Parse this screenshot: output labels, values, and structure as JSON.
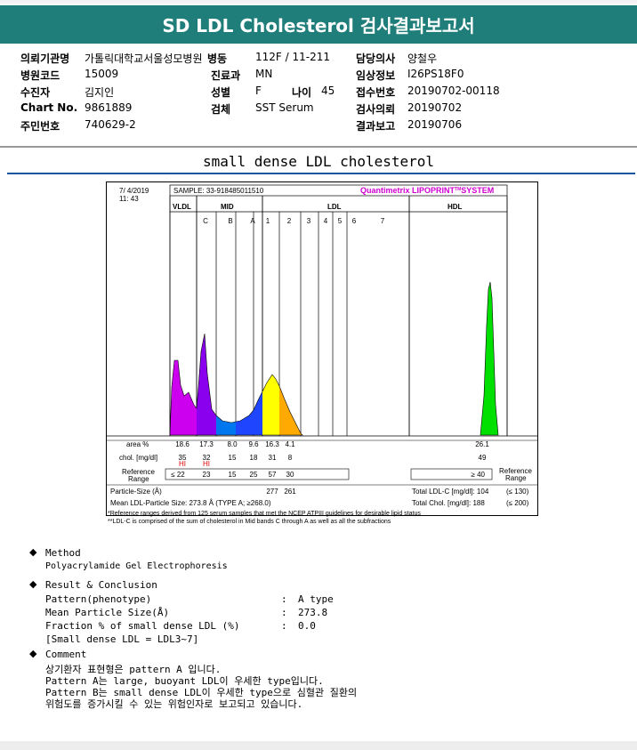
{
  "header": {
    "title": "SD LDL Cholesterol 검사결과보고서"
  },
  "info": {
    "rows": [
      [
        {
          "label": "의뢰기관명",
          "value": "가톨릭대학교서울성모병원"
        },
        {
          "label": "병동",
          "value": "112F / 11-211"
        },
        {
          "label": "담당의사",
          "value": "양철우"
        }
      ],
      [
        {
          "label": "병원코드",
          "value": "15009"
        },
        {
          "label": "진료과",
          "value": "MN"
        },
        {
          "label": "임상정보",
          "value": "I26PS18F0"
        }
      ],
      [
        {
          "label": "수진자",
          "value": "김지인"
        },
        {
          "label": "성별",
          "value": "F"
        },
        {
          "label": "접수번호",
          "value": "20190702-00118"
        }
      ],
      [
        {
          "label": "Chart No.",
          "value": "9861889"
        },
        {
          "label": "검체",
          "value": "SST Serum"
        },
        {
          "label": "검사의뢰",
          "value": "20190702"
        }
      ],
      [
        {
          "label": "주민번호",
          "value": "740629-2"
        },
        {
          "label": "",
          "value": ""
        },
        {
          "label": "결과보고",
          "value": "20190706"
        }
      ]
    ],
    "age_label": "나이",
    "age_value": "45"
  },
  "section_title": "small dense LDL cholesterol",
  "chart": {
    "date": "7/ 4/2019",
    "time": "11: 43",
    "sample": "SAMPLE:  33-918485011510",
    "brand": "Quantimetrix LIPOPRINT",
    "brand_tm": "TM",
    "brand_suffix": "SYSTEM",
    "group_vldl": "VLDL",
    "group_mid": "MID",
    "group_ldl": "LDL",
    "group_hdl": "HDL",
    "sub_bands": [
      "C",
      "B",
      "A",
      "1",
      "2",
      "3",
      "4",
      "5",
      "6",
      "7"
    ],
    "row_labels": {
      "area": "area %",
      "chol": "chol. [mg/dl]",
      "ref": "Reference Range",
      "particle": "Particle-Size (Å)",
      "mean": "Mean LDL-Particle Size:  273.8 Å  (TYPE A; ≥268.0)"
    },
    "area": [
      "18.6",
      "17.3",
      "8.0",
      "9.6",
      "16.3",
      "4.1"
    ],
    "area_hdl": "26.1",
    "chol": [
      "35",
      "32",
      "15",
      "18",
      "31",
      "8"
    ],
    "chol_hdl": "49",
    "hi": [
      "HI",
      "HI"
    ],
    "ref": [
      "≤ 22",
      "23",
      "15",
      "25",
      "57",
      "30"
    ],
    "ref_hdl": "≥ 40",
    "ref_side": "Reference Range",
    "particle": [
      "277",
      "261"
    ],
    "total_ldl": "Total LDL-C [mg/dl]:  104",
    "total_ldl_ref": "(≤ 130)",
    "total_chol": "Total Chol. [mg/dl]:  188",
    "total_chol_ref": "(≤ 200)"
  },
  "chart_data": {
    "type": "area",
    "title": "small dense LDL cholesterol",
    "bands": [
      "VLDL",
      "C",
      "B",
      "A",
      "1",
      "2",
      "3",
      "HDL"
    ],
    "area_percent": [
      18.6,
      17.3,
      8.0,
      9.6,
      16.3,
      4.1,
      26.1
    ],
    "chol_mg_dl": [
      35,
      32,
      15,
      18,
      31,
      8,
      49
    ],
    "colors": {
      "vldl": "#cc00ee",
      "c": "#8a00ee",
      "b": "#0077ee",
      "a": "#1f45ff",
      "ldl1": "#ffff00",
      "ldl2": "#ffaa00",
      "hdl": "#00e000"
    }
  },
  "footnotes": [
    "*Reference ranges derived from 125 serum samples that met the NCEP ATPIII guidelines for desirable lipid status",
    "**LDL-C is comprised of the sum of cholesterol in Mid bands C through A as well as all the subfractions"
  ],
  "method": {
    "title": "Method",
    "body": "Polyacrylamide Gel Electrophoresis"
  },
  "result": {
    "title": "Result & Conclusion",
    "lines": [
      {
        "k": "Pattern(phenotype)",
        "v": "A type"
      },
      {
        "k": "Mean Particle Size(Å)",
        "v": "273.8"
      },
      {
        "k": "Fraction % of small dense LDL (%)",
        "v": "0.0"
      }
    ],
    "note": "[Small dense LDL = LDL3~7]"
  },
  "comment": {
    "title": "Comment",
    "lines": [
      "상기환자 표현형은 pattern A 입니다.",
      "Pattern A는 large, buoyant LDL이 우세한 type입니다.",
      "Pattern B는 small dense LDL이 우세한 type으로 심혈관 질환의",
      "위험도를 증가시킬 수 있는 위험인자로 보고되고 있습니다."
    ]
  }
}
